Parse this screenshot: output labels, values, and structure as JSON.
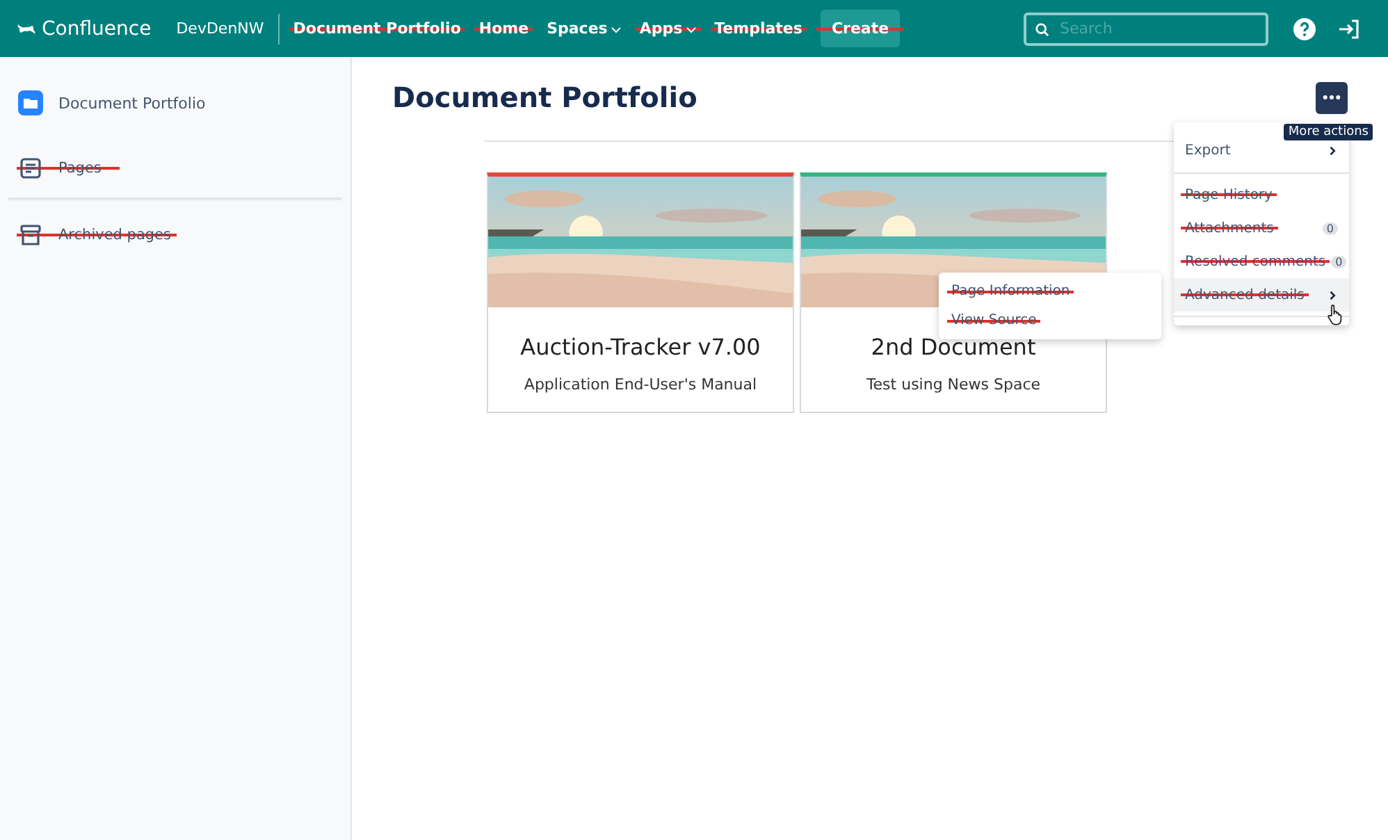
{
  "topbar": {
    "logo": "Confluence",
    "space": "DevDenNW",
    "nav": [
      {
        "label": "Document Portfolio",
        "kind": "link",
        "struck": true,
        "caret": false
      },
      {
        "label": "Home",
        "kind": "link",
        "struck": true,
        "caret": false
      },
      {
        "label": "Spaces",
        "kind": "link",
        "struck": false,
        "caret": true
      },
      {
        "label": "Apps",
        "kind": "link",
        "struck": true,
        "caret": true
      },
      {
        "label": "Templates",
        "kind": "link",
        "struck": true,
        "caret": false
      },
      {
        "label": "Create",
        "kind": "button",
        "struck": true,
        "caret": false
      }
    ],
    "search": {
      "placeholder": "Search"
    }
  },
  "sidebar": {
    "space": "Document Portfolio",
    "items": [
      {
        "label": "Pages",
        "kind": "pages",
        "struck": true
      },
      {
        "label": "Archived pages",
        "kind": "archive",
        "struck": true
      }
    ]
  },
  "page": {
    "title": "Document Portfolio",
    "cards": [
      {
        "title": "Auction-Tracker v7.00",
        "subtitle": "Application End-User's Manual",
        "color": "#e2483d"
      },
      {
        "title": "2nd Document",
        "subtitle": "Test using News Space",
        "color": "#36b37e"
      }
    ]
  },
  "more_actions": {
    "tooltip": "More actions",
    "menu": [
      {
        "label": "Export",
        "struck": false,
        "submenu": true,
        "selected": false
      },
      {
        "label": "Page History",
        "struck": true,
        "submenu": false,
        "selected": false
      },
      {
        "label": "Attachments",
        "struck": true,
        "count": "0",
        "submenu": false,
        "selected": false
      },
      {
        "label": "Resolved comments",
        "struck": true,
        "count": "0",
        "submenu": false,
        "selected": false
      },
      {
        "label": "Advanced details",
        "struck": true,
        "submenu": true,
        "selected": true
      }
    ],
    "submenu": [
      {
        "label": "Page Information",
        "struck": true
      },
      {
        "label": "View Source",
        "struck": true
      }
    ]
  }
}
